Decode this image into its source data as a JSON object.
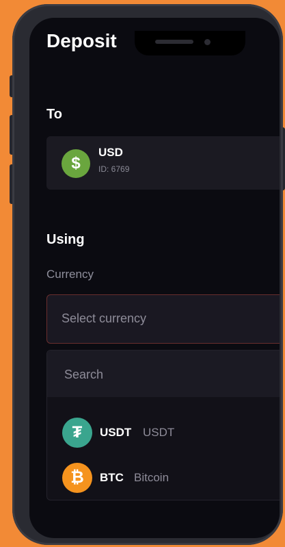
{
  "page": {
    "title": "Deposit"
  },
  "to_section": {
    "label": "To",
    "account": {
      "name": "USD",
      "id": "ID: 6769",
      "icon": "dollar-coin-icon",
      "icon_glyph": "$",
      "icon_color": "#6aa63e"
    }
  },
  "using_section": {
    "label": "Using",
    "currency_label": "Currency",
    "select_placeholder": "Select currency",
    "search_placeholder": "Search",
    "options": [
      {
        "symbol": "USDT",
        "name": "USDT",
        "icon": "tether-icon",
        "icon_glyph": "₮",
        "icon_color": "#3aa58e"
      },
      {
        "symbol": "BTC",
        "name": "Bitcoin",
        "icon": "bitcoin-icon",
        "icon_glyph": "₿",
        "icon_color": "#f5931e"
      }
    ]
  },
  "colors": {
    "background": "#f28a36",
    "screen": "#0b0b11",
    "select_border": "#6a2e2e"
  }
}
